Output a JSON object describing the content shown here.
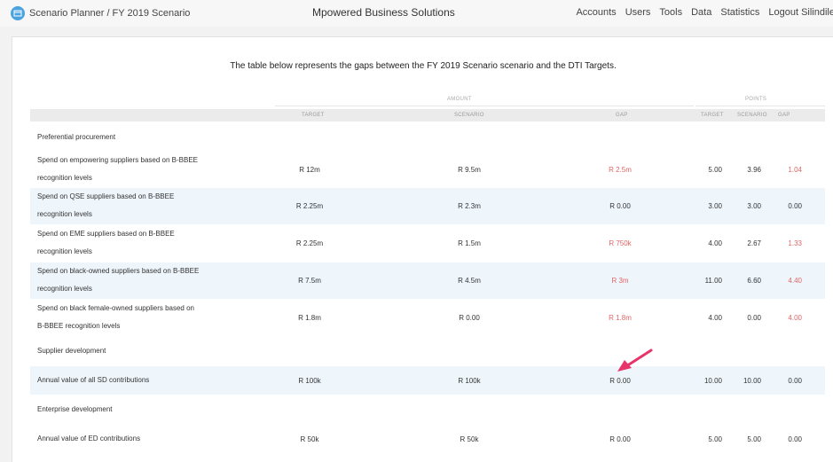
{
  "nav": {
    "breadcrumb": "Scenario Planner / FY 2019 Scenario",
    "app_title": "Mpowered Business Solutions",
    "menu": [
      "Accounts",
      "Users",
      "Tools",
      "Data",
      "Statistics",
      "Logout Silindile"
    ]
  },
  "intro": {
    "prefix": "The table below represents the gaps between the ",
    "scenario": "FY 2019 Scenario",
    "middle": " scenario and the ",
    "targets": "DTI Targets",
    "suffix": "."
  },
  "table": {
    "group_amount": "AMOUNT",
    "group_points": "POINTS",
    "headers": [
      "TARGET",
      "SCENARIO",
      "GAP",
      "TARGET",
      "SCENARIO",
      "GAP"
    ],
    "sections": [
      {
        "title": "Preferential procurement",
        "rows": [
          {
            "label_line1": "Spend on empowering suppliers based on B-BBEE",
            "label_line2": "recognition levels",
            "target": "R 12m",
            "scenario": "R 9.5m",
            "gap": "R 2.5m",
            "gap_red": true,
            "p_target": "5.00",
            "p_scenario": "3.96",
            "p_gap": "1.04",
            "p_gap_red": true
          },
          {
            "label_line1": "Spend on QSE suppliers based on B-BBEE",
            "label_line2": "recognition levels",
            "target": "R 2.25m",
            "scenario": "R 2.3m",
            "gap": "R 0.00",
            "gap_red": false,
            "p_target": "3.00",
            "p_scenario": "3.00",
            "p_gap": "0.00",
            "p_gap_red": false
          },
          {
            "label_line1": "Spend on EME suppliers based on B-BBEE",
            "label_line2": "recognition levels",
            "target": "R 2.25m",
            "scenario": "R 1.5m",
            "gap": "R 750k",
            "gap_red": true,
            "p_target": "4.00",
            "p_scenario": "2.67",
            "p_gap": "1.33",
            "p_gap_red": true
          },
          {
            "label_line1": "Spend on black-owned suppliers based on B-BBEE",
            "label_line2": "recognition levels",
            "target": "R 7.5m",
            "scenario": "R 4.5m",
            "gap": "R 3m",
            "gap_red": true,
            "p_target": "11.00",
            "p_scenario": "6.60",
            "p_gap": "4.40",
            "p_gap_red": true
          },
          {
            "label_line1": "Spend on black female-owned suppliers based on",
            "label_line2": "B-BBEE recognition levels",
            "target": "R 1.8m",
            "scenario": "R 0.00",
            "gap": "R 1.8m",
            "gap_red": true,
            "p_target": "4.00",
            "p_scenario": "0.00",
            "p_gap": "4.00",
            "p_gap_red": true
          }
        ]
      },
      {
        "title": "Supplier development",
        "rows": [
          {
            "label_line1": "Annual value of all SD contributions",
            "label_line2": "",
            "target": "R 100k",
            "scenario": "R 100k",
            "gap": "R 0.00",
            "gap_red": false,
            "p_target": "10.00",
            "p_scenario": "10.00",
            "p_gap": "0.00",
            "p_gap_red": false
          }
        ]
      },
      {
        "title": "Enterprise development",
        "rows": [
          {
            "label_line1": "Annual value of ED contributions",
            "label_line2": "",
            "target": "R 50k",
            "scenario": "R 50k",
            "gap": "R 0.00",
            "gap_red": false,
            "p_target": "5.00",
            "p_scenario": "5.00",
            "p_gap": "0.00",
            "p_gap_red": false
          }
        ]
      }
    ]
  },
  "colors": {
    "accent": "#4aa3df",
    "gap_red": "#e06666",
    "row_alt": "#eef6fc",
    "annotation_arrow": "#e8336b"
  },
  "icons": {
    "brand": "planner-icon",
    "annotation": "annotation-arrow-icon"
  }
}
